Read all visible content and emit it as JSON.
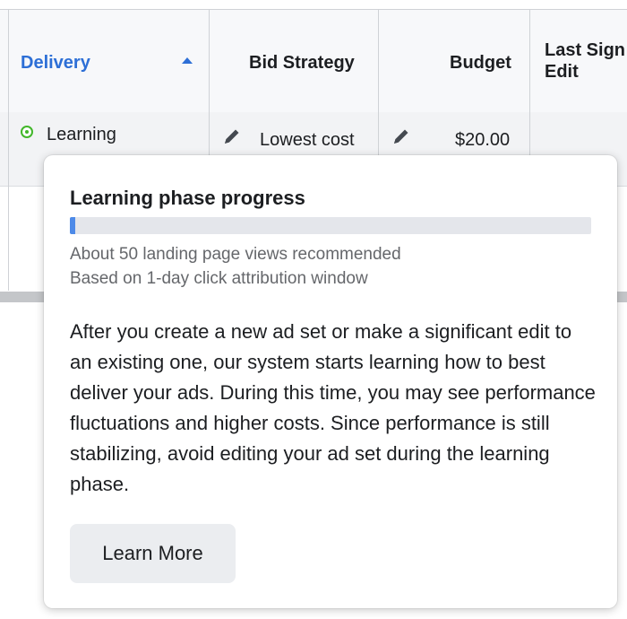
{
  "table": {
    "columns": {
      "delivery": "Delivery",
      "bid_strategy": "Bid Strategy",
      "budget": "Budget",
      "last_significant_edit_line1": "Last Sign",
      "last_significant_edit_line2": "Edit"
    },
    "sort": {
      "column": "delivery",
      "direction": "ascending"
    },
    "row": {
      "delivery_status": "Learning",
      "bid_strategy": "Lowest cost",
      "budget": "$20.00",
      "last_significant_edit": ""
    }
  },
  "tooltip": {
    "title": "Learning phase progress",
    "progress_fraction": 0.01,
    "recommendation": "About 50 landing page views recommended",
    "attribution": "Based on 1-day click attribution window",
    "body": "After you create a new ad set or make a significant edit to an existing one, our system starts learning how to best deliver your ads. During this time, you may see performance fluctuations and higher costs. Since performance is still stabilizing, avoid editing your ad set during the learning phase.",
    "button_label": "Learn More"
  },
  "colors": {
    "accent_blue": "#2d6fd6",
    "status_green": "#42b72a",
    "progress_fill": "#4d8ae8",
    "progress_track": "#e4e6eb"
  },
  "icons": {
    "sort": "sort-ascending-icon",
    "status": "status-dot-icon",
    "edit": "pencil-icon"
  }
}
